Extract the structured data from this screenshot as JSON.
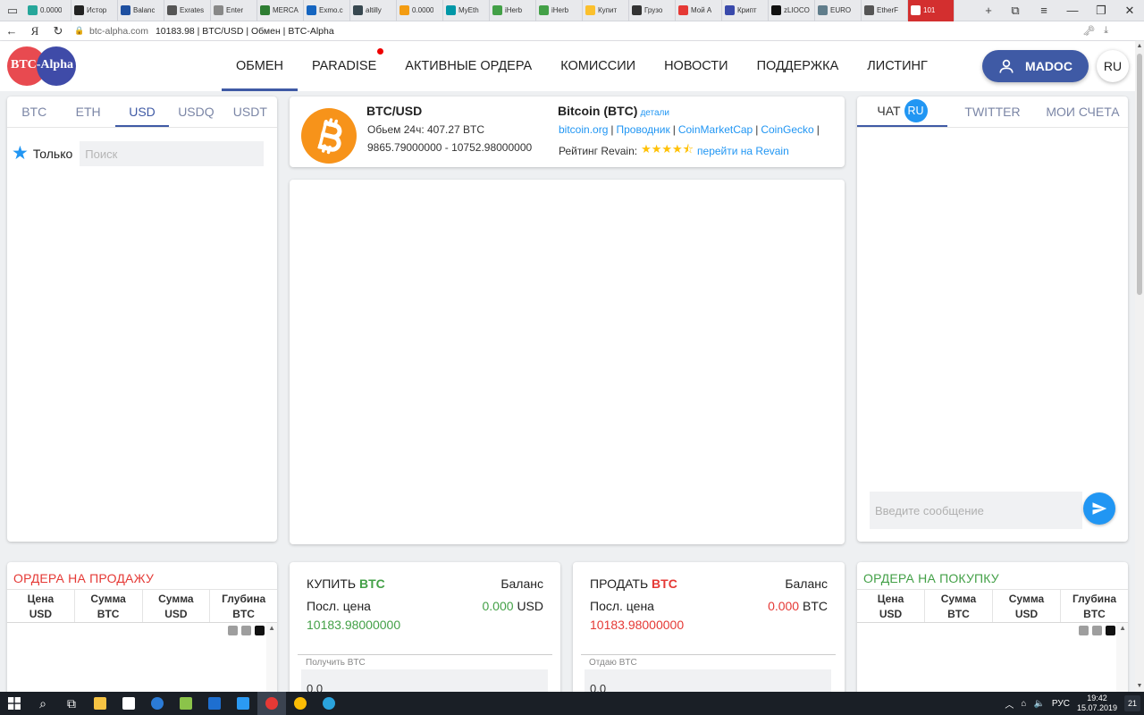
{
  "browser": {
    "tabs": [
      {
        "label": "0.0000",
        "color": "#26a69a"
      },
      {
        "label": "Истор",
        "color": "#222222"
      },
      {
        "label": "Balanc",
        "color": "#1e4fa0"
      },
      {
        "label": "Exrates",
        "color": "#555555"
      },
      {
        "label": "Enter",
        "color": "#888888"
      },
      {
        "label": "MERCA",
        "color": "#2e7d32"
      },
      {
        "label": "Exmo.c",
        "color": "#1565c0"
      },
      {
        "label": "altilly",
        "color": "#37474f"
      },
      {
        "label": "0.0000",
        "color": "#f39c12"
      },
      {
        "label": "MyEth",
        "color": "#0097a7"
      },
      {
        "label": "iHerb",
        "color": "#43a047"
      },
      {
        "label": "iHerb",
        "color": "#43a047"
      },
      {
        "label": "Купит",
        "color": "#fbc02d"
      },
      {
        "label": "Грузо",
        "color": "#333333"
      },
      {
        "label": "Мой А",
        "color": "#e53935"
      },
      {
        "label": "Крипт",
        "color": "#3949ab"
      },
      {
        "label": "zLIOCO",
        "color": "#111111"
      },
      {
        "label": "EURO",
        "color": "#607d8b"
      },
      {
        "label": "EtherF",
        "color": "#555555"
      },
      {
        "label": "101",
        "color": "#ffffff"
      }
    ],
    "active_tab_index": 19,
    "url_domain": "btc-alpha.com",
    "page_title": "10183.98 | BTC/USD | Обмен | BTC-Alpha"
  },
  "header": {
    "logo_text": "BTC-Alpha",
    "nav": [
      {
        "label": "ОБМЕН",
        "active": true,
        "dot": false
      },
      {
        "label": "PARADISE",
        "active": false,
        "dot": true
      },
      {
        "label": "АКТИВНЫЕ ОРДЕРА",
        "active": false,
        "dot": false
      },
      {
        "label": "КОМИССИИ",
        "active": false,
        "dot": false
      },
      {
        "label": "НОВОСТИ",
        "active": false,
        "dot": false
      },
      {
        "label": "ПОДДЕРЖКА",
        "active": false,
        "dot": false
      },
      {
        "label": "ЛИСТИНГ",
        "active": false,
        "dot": false
      }
    ],
    "user_name": "MADOC",
    "lang": "RU"
  },
  "markets": {
    "tabs": [
      {
        "label": "BTC",
        "active": false
      },
      {
        "label": "ETH",
        "active": false
      },
      {
        "label": "USD",
        "active": true
      },
      {
        "label": "USDQ",
        "active": false
      },
      {
        "label": "USDT",
        "active": false
      }
    ],
    "only_label": "Только",
    "search_placeholder": "Поиск"
  },
  "pair": {
    "title": "BTC/USD",
    "volume_label": "Обьем 24ч: 407.27 BTC",
    "range": "9865.79000000 - 10752.98000000",
    "coin_title": "Bitcoin (BTC)",
    "details_link": "детали",
    "links": [
      "bitcoin.org",
      "Проводник",
      "CoinMarketCap",
      "CoinGecko"
    ],
    "links_separator": "|",
    "rating_label": "Рейтинг Revain:",
    "rating_value": 4.5,
    "revain_link": "перейти на Revain"
  },
  "chat": {
    "tabs": [
      {
        "label": "ЧАТ",
        "badge": "RU",
        "active": true
      },
      {
        "label": "TWITTER",
        "badge": "",
        "active": false
      },
      {
        "label": "МОИ СЧЕТА",
        "badge": "",
        "active": false
      }
    ],
    "input_placeholder": "Введите сообщение"
  },
  "sell_orders": {
    "title": "ОРДЕРА НА ПРОДАЖУ",
    "columns": [
      {
        "line1": "Цена",
        "line2": "USD"
      },
      {
        "line1": "Сумма",
        "line2": "BTC"
      },
      {
        "line1": "Сумма",
        "line2": "USD"
      },
      {
        "line1": "Глубина",
        "line2": "BTC"
      }
    ]
  },
  "buy_orders": {
    "title": "ОРДЕРА НА ПОКУПКУ",
    "columns": [
      {
        "line1": "Цена",
        "line2": "USD"
      },
      {
        "line1": "Сумма",
        "line2": "BTC"
      },
      {
        "line1": "Сумма",
        "line2": "USD"
      },
      {
        "line1": "Глубина",
        "line2": "BTC"
      }
    ]
  },
  "buy_form": {
    "action": "КУПИТЬ",
    "currency": "BTC",
    "balance_label": "Баланс",
    "last_price_label": "Посл. цена",
    "balance_value": "0.000",
    "balance_currency": "USD",
    "last_price": "10183.98000000",
    "field_label": "Получить BTC",
    "field_value": "0.0"
  },
  "sell_form": {
    "action": "ПРОДАТЬ",
    "currency": "BTC",
    "balance_label": "Баланс",
    "last_price_label": "Посл. цена",
    "balance_value": "0.000",
    "balance_currency": "BTC",
    "last_price": "10183.98000000",
    "field_label": "Отдаю BTC",
    "field_value": "0.0"
  },
  "taskbar": {
    "apps": [
      {
        "name": "search-icon",
        "color": ""
      },
      {
        "name": "task-view-icon",
        "color": ""
      },
      {
        "name": "explorer-icon",
        "color": "#f6c343"
      },
      {
        "name": "store-icon",
        "color": "#ffffff"
      },
      {
        "name": "edge-icon",
        "color": "#2b7bd6"
      },
      {
        "name": "files-icon",
        "color": "#8bc34a"
      },
      {
        "name": "outlook-icon",
        "color": "#1e6fd0"
      },
      {
        "name": "ie-icon",
        "color": "#2b9af3"
      },
      {
        "name": "yandex-browser-icon",
        "color": "#e53935"
      },
      {
        "name": "chrome-icon",
        "color": "#fbbc05"
      },
      {
        "name": "telegram-icon",
        "color": "#2aa3dc"
      }
    ],
    "lang": "РУС",
    "time": "19:42",
    "date": "15.07.2019",
    "notifications": "21"
  }
}
